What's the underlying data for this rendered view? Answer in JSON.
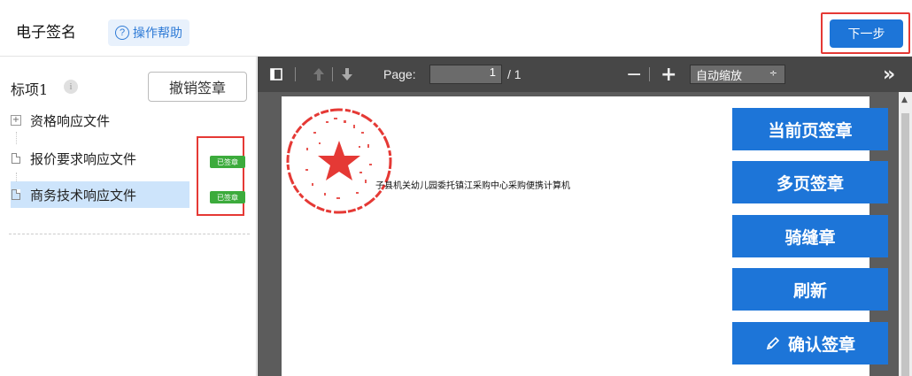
{
  "header": {
    "title": "电子签名",
    "help_label": "操作帮助",
    "next_label": "下一步"
  },
  "left_panel": {
    "lot_label": "标项1",
    "info_symbol": "i",
    "revoke_label": "撤销签章",
    "tree": [
      {
        "label": "资格响应文件",
        "icon": "expand-plus-icon"
      },
      {
        "label": "报价要求响应文件",
        "icon": "file-icon",
        "badge": "已签章"
      },
      {
        "label": "商务技术响应文件",
        "icon": "file-icon",
        "badge": "已签章",
        "selected": true
      }
    ]
  },
  "viewer": {
    "toolbar": {
      "page_label": "Page:",
      "page_value": "1",
      "page_total": "/ 1",
      "zoom_out": "−",
      "zoom_in": "+",
      "zoom_value": "自动缩放",
      "zoom_arrow": "÷",
      "more": "»"
    },
    "document_text": "子县机关幼儿园委托镇江采购中心采购便携计算机",
    "actions": {
      "current_page_sign": "当前页签章",
      "multi_page_sign": "多页签章",
      "seam_seal": "骑缝章",
      "refresh": "刷新",
      "confirm_seal": "确认签章"
    }
  },
  "colors": {
    "primary": "#1d75d8",
    "highlight_border": "#e53935",
    "badge_green": "#3cab3c",
    "toolbar": "#474747",
    "stamp_red": "#e53935"
  }
}
